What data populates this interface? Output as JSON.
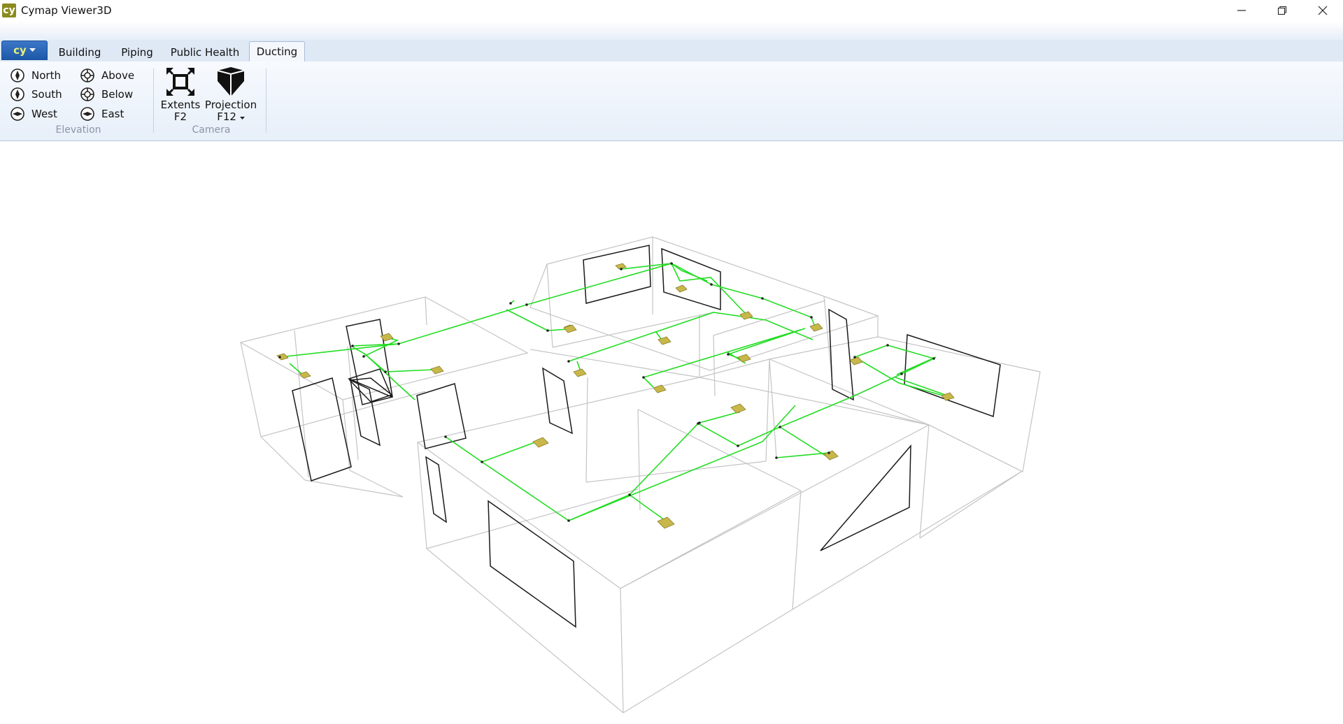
{
  "window": {
    "title": "Cymap Viewer3D",
    "logo_text": "cy",
    "controls": [
      "minimize-icon",
      "restore-icon",
      "close-icon"
    ]
  },
  "tabs": {
    "app_menu_icon": "cy",
    "items": [
      "Building",
      "Piping",
      "Public Health",
      "Ducting"
    ],
    "active": "Ducting"
  },
  "ribbon": {
    "elevation": {
      "label": "Elevation",
      "items": [
        "North",
        "South",
        "West",
        "Above",
        "Below",
        "East"
      ]
    },
    "camera": {
      "label": "Camera",
      "extents": {
        "line1": "Extents",
        "line2": "F2"
      },
      "projection": {
        "line1": "Projection",
        "line2": "F12"
      }
    }
  },
  "colors": {
    "duct": "#22dd22",
    "wireframe": "#c4c4c4",
    "opening": "#1a1a1a",
    "diffuser": "#c8b84a",
    "accent": "#1d58a8"
  }
}
